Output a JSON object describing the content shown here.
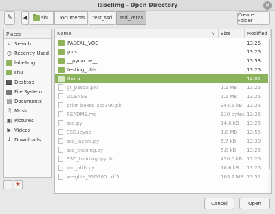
{
  "window": {
    "title": "labelImg - Open Directory",
    "close_glyph": "×"
  },
  "toolbar": {
    "edit_glyph": "✎",
    "back_glyph": "◀",
    "crumbs": [
      "shu",
      "Documents",
      "test_ssd",
      "ssd_keras"
    ],
    "create_folder": "Create Folder"
  },
  "places": {
    "header": "Places",
    "items": [
      {
        "label": "Search",
        "icon": "search-icon",
        "glyph": "⌕"
      },
      {
        "label": "Recently Used",
        "icon": "clock-icon",
        "glyph": "◷"
      },
      {
        "label": "labelImg",
        "icon": "folder-icon"
      },
      {
        "label": "shu",
        "icon": "home-folder-icon"
      },
      {
        "label": "Desktop",
        "icon": "desktop-icon"
      },
      {
        "label": "File System",
        "icon": "drive-icon"
      },
      {
        "label": "Documents",
        "icon": "documents-icon",
        "glyph": "▤"
      },
      {
        "label": "Music",
        "icon": "music-icon",
        "glyph": "♫"
      },
      {
        "label": "Pictures",
        "icon": "pictures-icon",
        "glyph": "▣"
      },
      {
        "label": "Videos",
        "icon": "videos-icon",
        "glyph": "▶"
      },
      {
        "label": "Downloads",
        "icon": "downloads-icon",
        "glyph": "↓"
      }
    ],
    "add_glyph": "+",
    "remove_glyph": "✖"
  },
  "files": {
    "columns": {
      "name": "Name",
      "size": "Size",
      "modified": "Modified"
    },
    "sort_glyph": "∨",
    "rows": [
      {
        "name": "PASCAL_VOC",
        "size": "",
        "modified": "13:25",
        "type": "folder",
        "state": "normal"
      },
      {
        "name": "pics",
        "size": "",
        "modified": "13:25",
        "type": "folder",
        "state": "normal"
      },
      {
        "name": "__pycache__",
        "size": "",
        "modified": "13:53",
        "type": "folder",
        "state": "normal"
      },
      {
        "name": "testing_utils",
        "size": "",
        "modified": "13:25",
        "type": "folder",
        "state": "normal"
      },
      {
        "name": "thora",
        "size": "",
        "modified": "14:01",
        "type": "folder",
        "state": "selected"
      },
      {
        "name": "gt_pascal.pkl",
        "size": "1.1 MB",
        "modified": "13:25",
        "type": "file",
        "state": "dimmed"
      },
      {
        "name": "LICENSE",
        "size": "1.1 MB",
        "modified": "13:25",
        "type": "file",
        "state": "dimmed"
      },
      {
        "name": "prior_boxes_ssd300.pkl",
        "size": "344.5 kB",
        "modified": "13:25",
        "type": "file",
        "state": "dimmed"
      },
      {
        "name": "README.md",
        "size": "910 bytes",
        "modified": "13:25",
        "type": "file",
        "state": "dimmed"
      },
      {
        "name": "ssd.py",
        "size": "14.6 kB",
        "modified": "13:25",
        "type": "file",
        "state": "dimmed"
      },
      {
        "name": "SSD.ipynb",
        "size": "1.8 MB",
        "modified": "13:55",
        "type": "file",
        "state": "dimmed"
      },
      {
        "name": "ssd_layers.py",
        "size": "6.7 kB",
        "modified": "13:30",
        "type": "file",
        "state": "dimmed"
      },
      {
        "name": "ssd_training.py",
        "size": "5.8 kB",
        "modified": "13:25",
        "type": "file",
        "state": "dimmed"
      },
      {
        "name": "SSD_training.ipynb",
        "size": "420.0 kB",
        "modified": "13:25",
        "type": "file",
        "state": "dimmed"
      },
      {
        "name": "ssd_utils.py",
        "size": "10.6 kB",
        "modified": "13:25",
        "type": "file",
        "state": "dimmed"
      },
      {
        "name": "weights_SSD300.hdf5",
        "size": "103.2 MB",
        "modified": "13:51",
        "type": "file",
        "state": "dimmed"
      }
    ]
  },
  "buttons": {
    "cancel": "Cancel",
    "open": "Open"
  }
}
